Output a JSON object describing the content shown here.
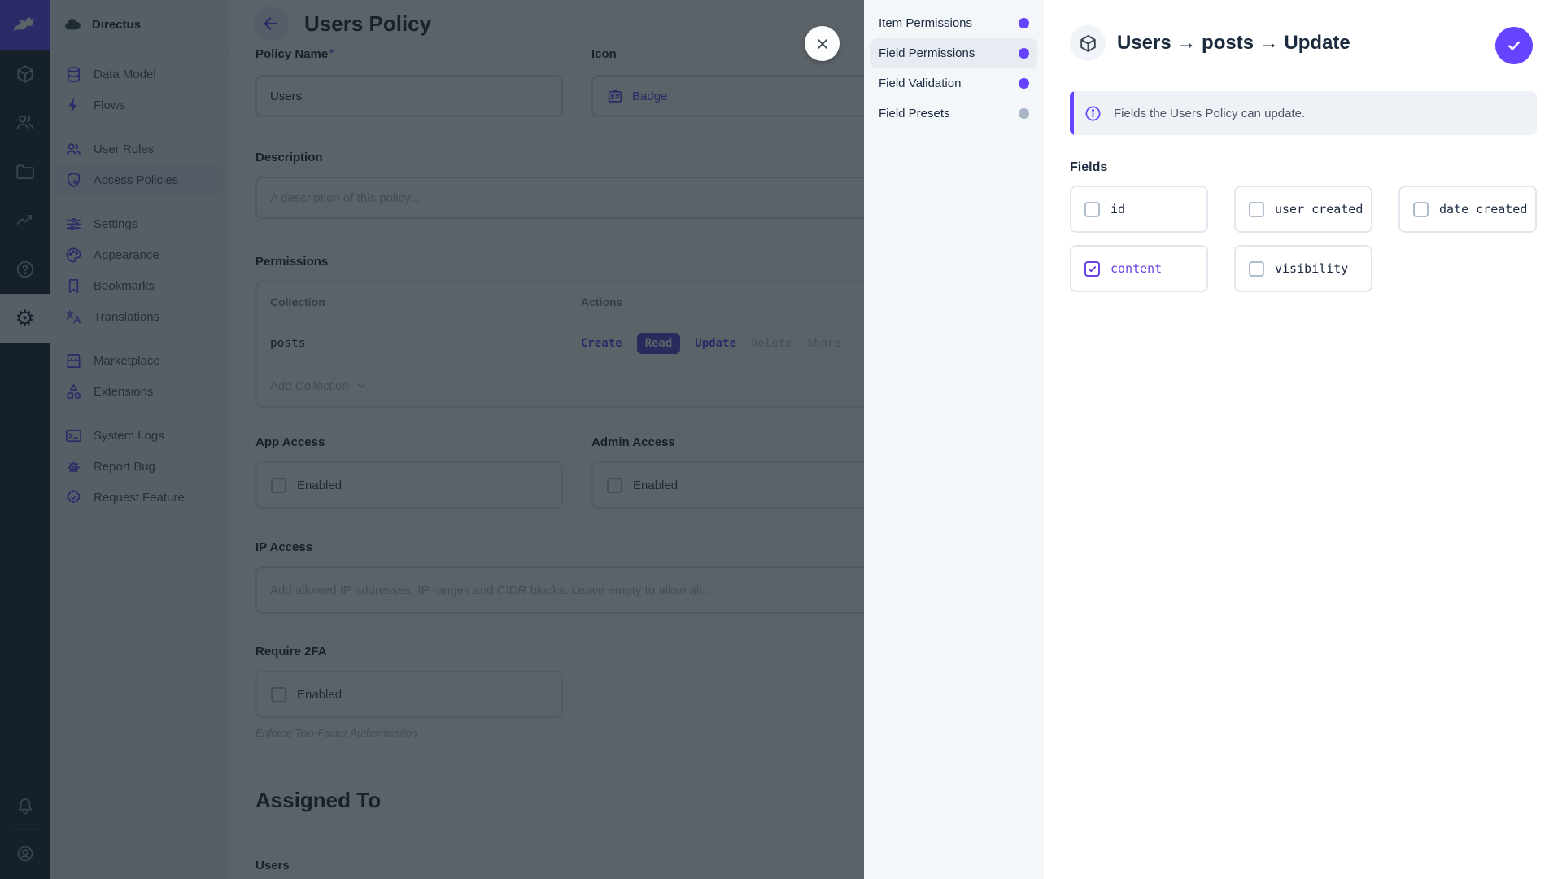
{
  "colors": {
    "purple": "#6644FF",
    "module_bar_bg": "#18222F",
    "sidebar_bg": "#F0F4F9",
    "dot_active": "#6644FF",
    "dot_inactive": "#A9B6C6"
  },
  "module_bar": {
    "logo_icon": "directus-rabbit-icon",
    "modules": [
      "content-cube-icon",
      "users-icon",
      "files-folder-icon",
      "insights-chart-icon",
      "help-icon",
      "settings-gear-icon"
    ],
    "active_module": "settings",
    "bottom": [
      "notifications-bell-icon",
      "account-circle-icon"
    ]
  },
  "sidebar": {
    "project_name": "Directus",
    "items": [
      {
        "label": "Data Model"
      },
      {
        "label": "Flows"
      },
      {
        "label": "User Roles"
      },
      {
        "label": "Access Policies"
      },
      {
        "label": "Settings"
      },
      {
        "label": "Appearance"
      },
      {
        "label": "Bookmarks"
      },
      {
        "label": "Translations"
      },
      {
        "label": "Marketplace"
      },
      {
        "label": "Extensions"
      },
      {
        "label": "System Logs"
      },
      {
        "label": "Report Bug"
      },
      {
        "label": "Request Feature"
      }
    ],
    "active_item": "Access Policies"
  },
  "main": {
    "title": "Users Policy",
    "policy_name": {
      "label": "Policy Name",
      "required_mark": "*",
      "value": "Users"
    },
    "icon_field": {
      "label": "Icon",
      "value": "Badge"
    },
    "description": {
      "label": "Description",
      "placeholder": "A description of this policy..."
    },
    "permissions": {
      "label": "Permissions",
      "col_collection": "Collection",
      "col_actions": "Actions",
      "row": {
        "collection": "posts",
        "actions": [
          {
            "label": "Create",
            "state": "on"
          },
          {
            "label": "Read",
            "state": "pill"
          },
          {
            "label": "Update",
            "state": "on"
          },
          {
            "label": "Delete",
            "state": "off"
          },
          {
            "label": "Share",
            "state": "off"
          }
        ]
      },
      "add_collection": "Add Collection"
    },
    "app_access": {
      "label": "App Access",
      "checkbox": "Enabled"
    },
    "admin_access": {
      "label": "Admin Access",
      "checkbox": "Enabled"
    },
    "ip_access": {
      "label": "IP Access",
      "placeholder": "Add allowed IP addresses, IP ranges and CIDR blocks. Leave empty to allow all..."
    },
    "require_2fa": {
      "label": "Require 2FA",
      "checkbox": "Enabled",
      "note": "Enforce Two-Factor Authentication"
    },
    "assigned_to": {
      "title": "Assigned To",
      "users_label": "Users"
    }
  },
  "drawer": {
    "nav": [
      {
        "label": "Item Permissions",
        "dot": "#6644FF"
      },
      {
        "label": "Field Permissions",
        "dot": "#6644FF"
      },
      {
        "label": "Field Validation",
        "dot": "#6644FF"
      },
      {
        "label": "Field Presets",
        "dot": "#A9B6C6"
      }
    ],
    "active_nav": "Field Permissions",
    "header": {
      "title": "Users → posts → Update",
      "icon": "cube-icon"
    },
    "banner": {
      "text": "Fields the Users Policy can update."
    },
    "fields_label": "Fields",
    "fields": [
      {
        "name": "id",
        "checked": false
      },
      {
        "name": "user_created",
        "checked": false
      },
      {
        "name": "date_created",
        "checked": false
      },
      {
        "name": "content",
        "checked": true
      },
      {
        "name": "visibility",
        "checked": false
      }
    ]
  }
}
